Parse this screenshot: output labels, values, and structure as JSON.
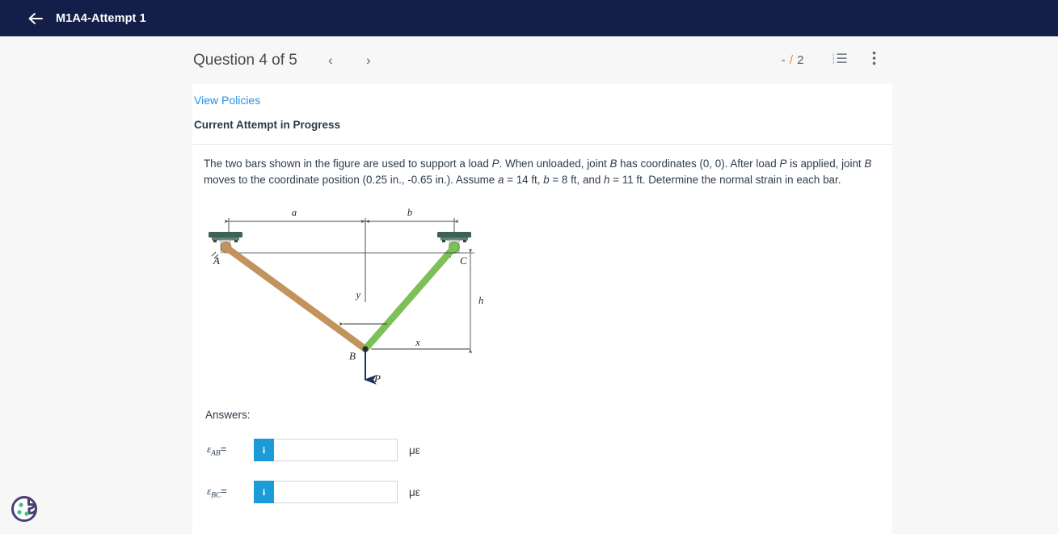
{
  "appbar": {
    "back_icon": "arrow-left-icon",
    "title": "M1A4-Attempt 1"
  },
  "question_header": {
    "title": "Question 4 of 5",
    "prev_label": "‹",
    "next_label": "›",
    "score_dash": "-",
    "score_slash": "/",
    "score_total": "2",
    "list_icon": "numbered-list-icon",
    "more_icon": "more-vertical-icon"
  },
  "card": {
    "view_policies": "View Policies",
    "attempt_status": "Current Attempt in Progress",
    "prompt": {
      "s1": "The two bars shown in the figure are used to support a load ",
      "P1": "P",
      "s2": ". When unloaded, joint ",
      "B1": "B",
      "s3": " has coordinates (0, 0). After load ",
      "P2": "P",
      "s4": " is applied, joint ",
      "B2": "B",
      "s5": " moves to the coordinate position (0.25 in., -0.65 in.). Assume ",
      "a": "a",
      "s6": " = 14 ft, ",
      "b": "b",
      "s7": " = 8 ft, and ",
      "h": "h",
      "s8": " = 11 ft. Determine the normal strain in each bar."
    },
    "answers_label": "Answers:",
    "answers": [
      {
        "symbol": "ε",
        "subscript": "AB",
        "equals": "=",
        "info": "i",
        "value": "",
        "placeholder": "",
        "unit": "με"
      },
      {
        "symbol": "ε",
        "subscript": "BC",
        "equals": "=",
        "info": "i",
        "value": "",
        "placeholder": "",
        "unit": "με"
      }
    ]
  },
  "figure": {
    "labels": {
      "a": "a",
      "b": "b",
      "h": "h",
      "x": "x",
      "y": "y",
      "A": "A",
      "B": "B",
      "C": "C",
      "P": "P"
    },
    "colors": {
      "bar_ab": "#c2935c",
      "bar_bc": "#7cc057",
      "support_plate": "#3d6152",
      "load_arrow": "#1f3160",
      "dimension_line": "#4a4a4a"
    }
  },
  "cookie_badge": {
    "icon": "cookie-icon",
    "outline_color": "#4b3f72",
    "dot_color": "#3fc18b"
  }
}
